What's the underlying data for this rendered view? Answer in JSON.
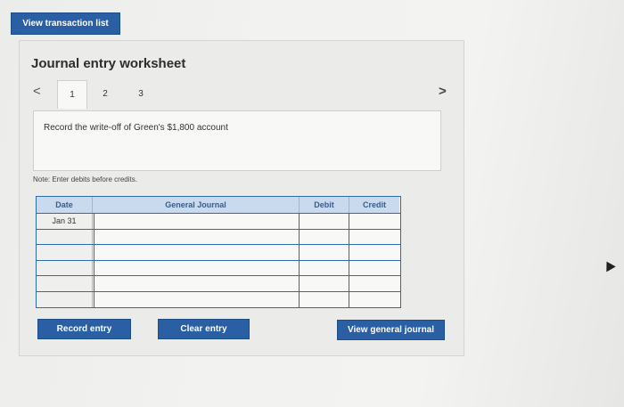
{
  "toolbar": {
    "view_transaction_list": "View transaction list"
  },
  "worksheet": {
    "title": "Journal entry worksheet",
    "tabs": [
      "1",
      "2",
      "3"
    ],
    "prompt": "Record the write-off of Green's $1,800 account",
    "note": "Note: Enter debits before credits."
  },
  "journal": {
    "headers": {
      "date": "Date",
      "general_journal": "General Journal",
      "debit": "Debit",
      "credit": "Credit"
    },
    "rows": [
      {
        "date": "Jan 31",
        "account": "",
        "debit": "",
        "credit": ""
      },
      {
        "date": "",
        "account": "",
        "debit": "",
        "credit": ""
      },
      {
        "date": "",
        "account": "",
        "debit": "",
        "credit": ""
      },
      {
        "date": "",
        "account": "",
        "debit": "",
        "credit": ""
      },
      {
        "date": "",
        "account": "",
        "debit": "",
        "credit": ""
      },
      {
        "date": "",
        "account": "",
        "debit": "",
        "credit": ""
      }
    ]
  },
  "actions": {
    "record_entry": "Record entry",
    "clear_entry": "Clear entry",
    "view_general_journal": "View general journal"
  },
  "icons": {
    "prev": "chevron-left-icon",
    "next": "chevron-right-icon",
    "cursor": "mouse-pointer-icon"
  },
  "colors": {
    "accent": "#2a5fa3",
    "header_bg": "#c9daee",
    "border": "#2d6aae"
  }
}
